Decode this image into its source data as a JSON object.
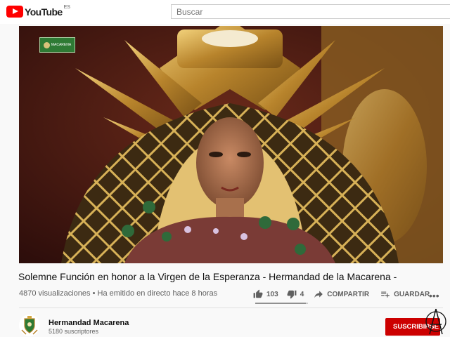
{
  "header": {
    "logo_text": "YouTube",
    "logo_country": "ES",
    "search_placeholder": "Buscar"
  },
  "video": {
    "overlay_badge_text": "MACARENA",
    "title": "Solemne Función en honor a la Virgen de la Esperanza - Hermandad de la Macarena -",
    "views": "4870 visualizaciones",
    "separator": "•",
    "stream_info": "Ha emitido en directo hace 8 horas"
  },
  "actions": {
    "likes": "103",
    "dislikes": "4",
    "like_ratio": 0.96,
    "share_label": "COMPARTIR",
    "save_label": "GUARDAR"
  },
  "channel": {
    "name": "Hermandad Macarena",
    "subscribers": "5180 suscriptores",
    "subscribe_label": "SUSCRIBIRSE"
  },
  "icons": {
    "like": "thumbs-up-icon",
    "dislike": "thumbs-down-icon",
    "share": "share-arrow-icon",
    "save": "playlist-add-icon",
    "more": "more-horizontal-icon"
  },
  "colors": {
    "brand_red": "#ff0000",
    "subscribe_red": "#cc0000",
    "overlay_green": "#2e7a34"
  }
}
